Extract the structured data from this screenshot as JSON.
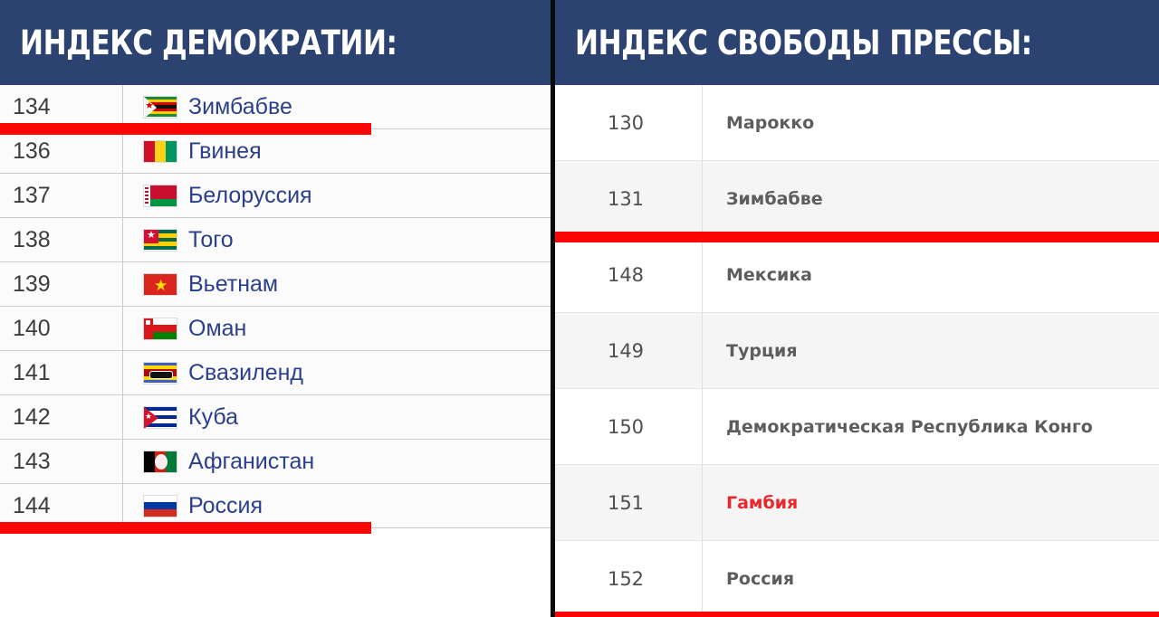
{
  "colors": {
    "header_bg": "#2c4270",
    "header_text": "#ffffff",
    "red_bar": "#fc0505",
    "left_country_text": "#2b3f8c",
    "right_country_text": "#5d5d5d",
    "highlight_text": "#e8282c",
    "divider": "#0a0a0a"
  },
  "left_panel": {
    "title": "ИНДЕКС ДЕМОКРАТИИ:",
    "rows": [
      {
        "rank": "134",
        "country": "Зимбабве",
        "flag": "zimbabwe"
      },
      {
        "rank": "136",
        "country": "Гвинея",
        "flag": "guinea"
      },
      {
        "rank": "137",
        "country": "Белоруссия",
        "flag": "belarus"
      },
      {
        "rank": "138",
        "country": "Того",
        "flag": "togo"
      },
      {
        "rank": "139",
        "country": "Вьетнам",
        "flag": "vietnam"
      },
      {
        "rank": "140",
        "country": "Оман",
        "flag": "oman"
      },
      {
        "rank": "141",
        "country": "Свазиленд",
        "flag": "eswatini"
      },
      {
        "rank": "142",
        "country": "Куба",
        "flag": "cuba"
      },
      {
        "rank": "143",
        "country": "Афганистан",
        "flag": "afghanistan"
      },
      {
        "rank": "144",
        "country": "Россия",
        "flag": "russia"
      }
    ],
    "red_bars_after_row_index": [
      0,
      9
    ]
  },
  "right_panel": {
    "title": "ИНДЕКС СВОБОДЫ ПРЕССЫ:",
    "rows": [
      {
        "rank": "130",
        "country": "Марокко",
        "highlight": false
      },
      {
        "rank": "131",
        "country": "Зимбабве",
        "highlight": false
      },
      {
        "rank": "148",
        "country": "Мексика",
        "highlight": false
      },
      {
        "rank": "149",
        "country": "Турция",
        "highlight": false
      },
      {
        "rank": "150",
        "country": "Демократическая Республика Конго",
        "highlight": false
      },
      {
        "rank": "151",
        "country": "Гамбия",
        "highlight": true
      },
      {
        "rank": "152",
        "country": "Россия",
        "highlight": false
      }
    ],
    "red_bars_after_row_index": [
      1,
      6
    ]
  }
}
